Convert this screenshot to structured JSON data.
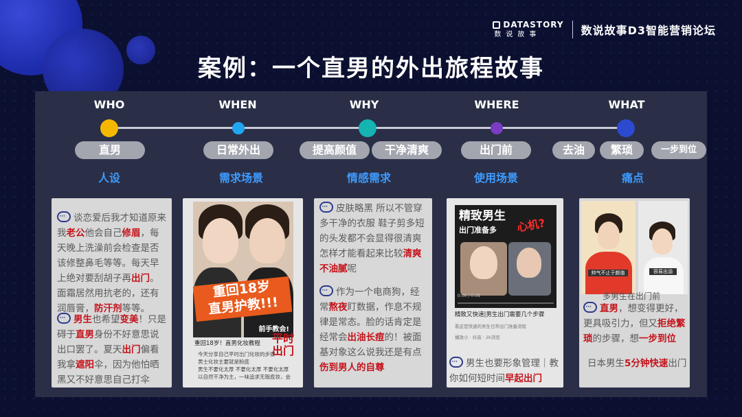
{
  "brand": {
    "logo_text": "DATASTORY",
    "logo_sub": "数说故事",
    "name": "数说故事D3智能营销论坛"
  },
  "title": "案例：一个直男的外出旅程故事",
  "timeline": {
    "headers": [
      "WHO",
      "WHEN",
      "WHY",
      "WHERE",
      "WHAT"
    ],
    "dot_colors": [
      "#f5b800",
      "#1ea7f0",
      "#16b3b3",
      "#7a3cc2",
      "#2c4ad0"
    ],
    "pills": [
      "直男",
      "日常外出",
      "提高颜值",
      "干净清爽",
      "出门前",
      "去油",
      "繁琐",
      "一步到位"
    ],
    "labels": [
      "人设",
      "需求场景",
      "情感需求",
      "使用场景",
      "痛点"
    ]
  },
  "cards": {
    "who": {
      "p1": [
        "谈恋爱后我才知道原来我",
        "老公",
        "他会自己",
        "修眉",
        "，每天晚上洗澡前会检查是否该修整鼻毛等等。每天早上绝对要刮胡子再",
        "出门",
        "。面霜居然用抗老的，还有润唇膏，",
        "防汗剂",
        "等等。"
      ],
      "p2": [
        "男生",
        "也希望",
        "变美",
        "！只是碍于",
        "直男",
        "身份不好意思说出口罢了。夏天",
        "出门",
        "偏看我拿",
        "遮阳",
        "伞，因为他怕晒黑又不好意思自己打伞"
      ]
    },
    "when": {
      "banner_line1": "重回18岁",
      "banner_line2": "直男护教!!!",
      "tag": "前手教会!",
      "caption_title": "重回18岁！直男化妆教程",
      "caption_lines": [
        "今天分享自己平时出门化妆的步骤",
        "男士化妆主要就是粉底",
        "男生不要化太厚 不要化太厚 不要化太厚",
        "以自然干净为主，一味追求无瑕底妆，会"
      ],
      "badge": "平时出门"
    },
    "why": {
      "p1": [
        "皮肤略黑  所以不管穿多干净的衣服  鞋子剪多短的头发都不会显得很清爽  怎样才能看起来比较",
        "清爽不油腻",
        "呢"
      ],
      "p2": [
        "作为一个电商狗，经常",
        "熬夜",
        "盯数据，作息不规律是常态。脸的话肯定是经常会",
        "出油长痘",
        "的！被面基对象这么说我还是有点",
        "伤到男人的自尊"
      ]
    },
    "where": {
      "banner_line1": "精致男生",
      "banner_line2": "出门准备多",
      "heart": "心机?",
      "video_time": "0:00 / 0:08",
      "caption_title": "精致又快速|男生出门需要几个步骤",
      "caption_sub": "看这是快速的男生日常出门准备流程",
      "meta": "播放小 · 抖音 · 2k浏览",
      "p": [
        "男生也要形象管理｜教你如何短时间",
        "早起出门"
      ]
    },
    "what": {
      "sign1": "帅气不止于颜值",
      "sign2": "容易出油",
      "overlay": "多男生在出门前",
      "p1": [
        "直男",
        "，想变得更好，更具吸引力，但又",
        "拒绝繁琐",
        "的步骤，想",
        "一步到位"
      ],
      "p2": [
        "日本男生",
        "5分钟快速",
        "出门"
      ]
    }
  }
}
